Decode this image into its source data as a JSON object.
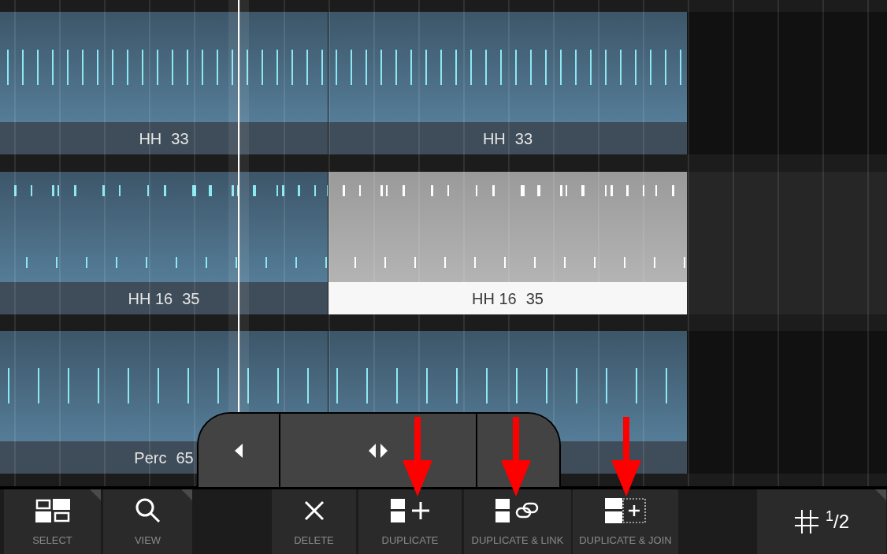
{
  "lanes": [
    {
      "clips": [
        {
          "name": "HH",
          "count": "33",
          "selected": false
        },
        {
          "name": "HH",
          "count": "33",
          "selected": false
        }
      ]
    },
    {
      "clips": [
        {
          "name": "HH 16",
          "count": "35",
          "selected": false
        },
        {
          "name": "HH 16",
          "count": "35",
          "selected": true
        }
      ]
    },
    {
      "clips": [
        {
          "name": "Perc",
          "count": "65",
          "selected": false
        },
        {
          "selected": false
        }
      ]
    }
  ],
  "toolbar": [
    {
      "kind": "select",
      "label": "SELECT",
      "corner": true
    },
    {
      "kind": "view",
      "label": "VIEW",
      "corner": true
    },
    {
      "kind": "spacer"
    },
    {
      "kind": "delete",
      "label": "DELETE",
      "corner": false
    },
    {
      "kind": "duplicate",
      "label": "DUPLICATE",
      "corner": false
    },
    {
      "kind": "duplicate_link",
      "label": "DUPLICATE & LINK",
      "corner": false
    },
    {
      "kind": "duplicate_join",
      "label": "DUPLICATE & JOIN",
      "corner": false
    },
    {
      "kind": "spacer_wide"
    },
    {
      "kind": "grid",
      "label": "$^{1}$/2",
      "corner": true
    }
  ]
}
